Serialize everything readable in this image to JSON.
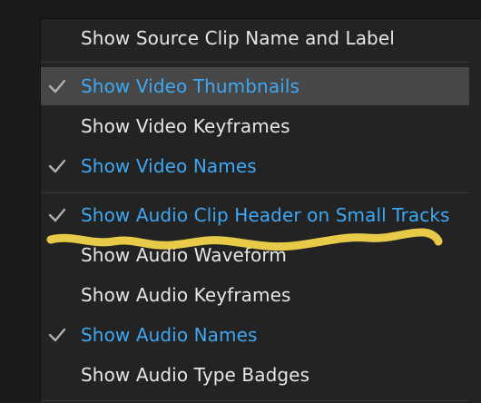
{
  "menu": {
    "items": [
      {
        "label": "Show Source Clip Name and Label",
        "checked": false
      },
      {
        "label": "Show Video Thumbnails",
        "checked": true,
        "highlighted": true
      },
      {
        "label": "Show Video Keyframes",
        "checked": false
      },
      {
        "label": "Show Video Names",
        "checked": true
      },
      {
        "label": "Show Audio Clip Header on Small Tracks",
        "checked": true
      },
      {
        "label": "Show Audio Waveform",
        "checked": false
      },
      {
        "label": "Show Audio Keyframes",
        "checked": false
      },
      {
        "label": "Show Audio Names",
        "checked": true
      },
      {
        "label": "Show Audio Type Badges",
        "checked": false
      }
    ]
  },
  "colors": {
    "checked_text": "#3ea8f4",
    "normal_text": "#e6e6e6",
    "highlight_bg": "#474747",
    "annotation": "#f7d94c"
  },
  "icons": {
    "check": "check-icon"
  }
}
